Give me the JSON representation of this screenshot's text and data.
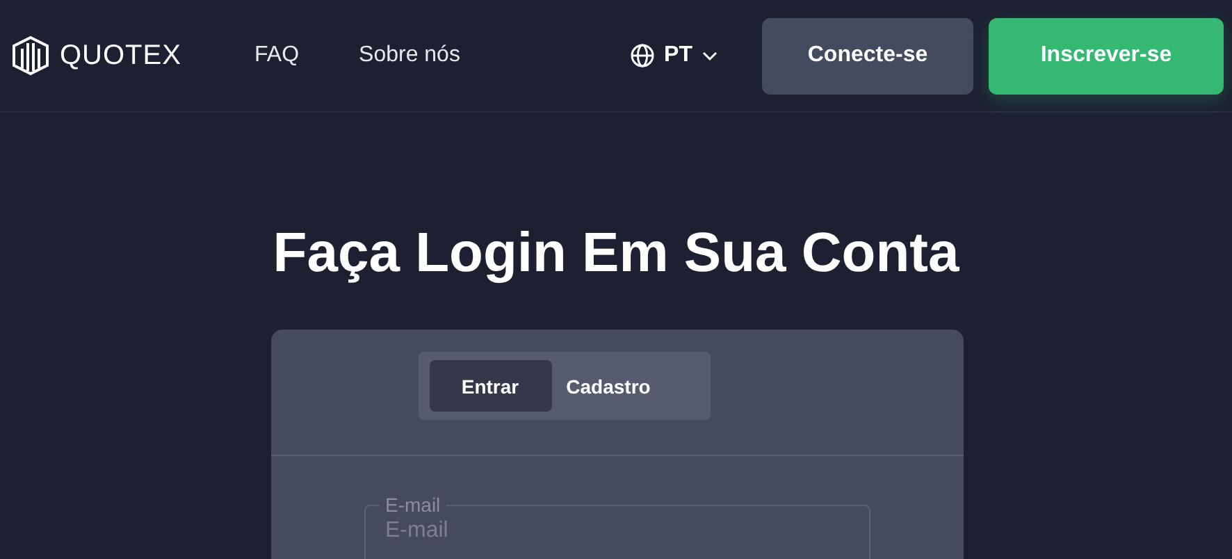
{
  "header": {
    "logo": "QUOTEX",
    "nav": [
      "FAQ",
      "Sobre nós"
    ],
    "language": "PT",
    "buttons": [
      {
        "label": "Conecte-se",
        "kind": "secondary"
      },
      {
        "label": "Inscrever-se",
        "kind": "primary"
      }
    ]
  },
  "title": "Faça Login Em Sua Conta",
  "tabs": [
    {
      "label": "Entrar",
      "selected": true
    },
    {
      "label": "Cadastro",
      "selected": false
    }
  ],
  "email_field": {
    "label": "E-mail",
    "placeholder": "E-mail"
  }
}
